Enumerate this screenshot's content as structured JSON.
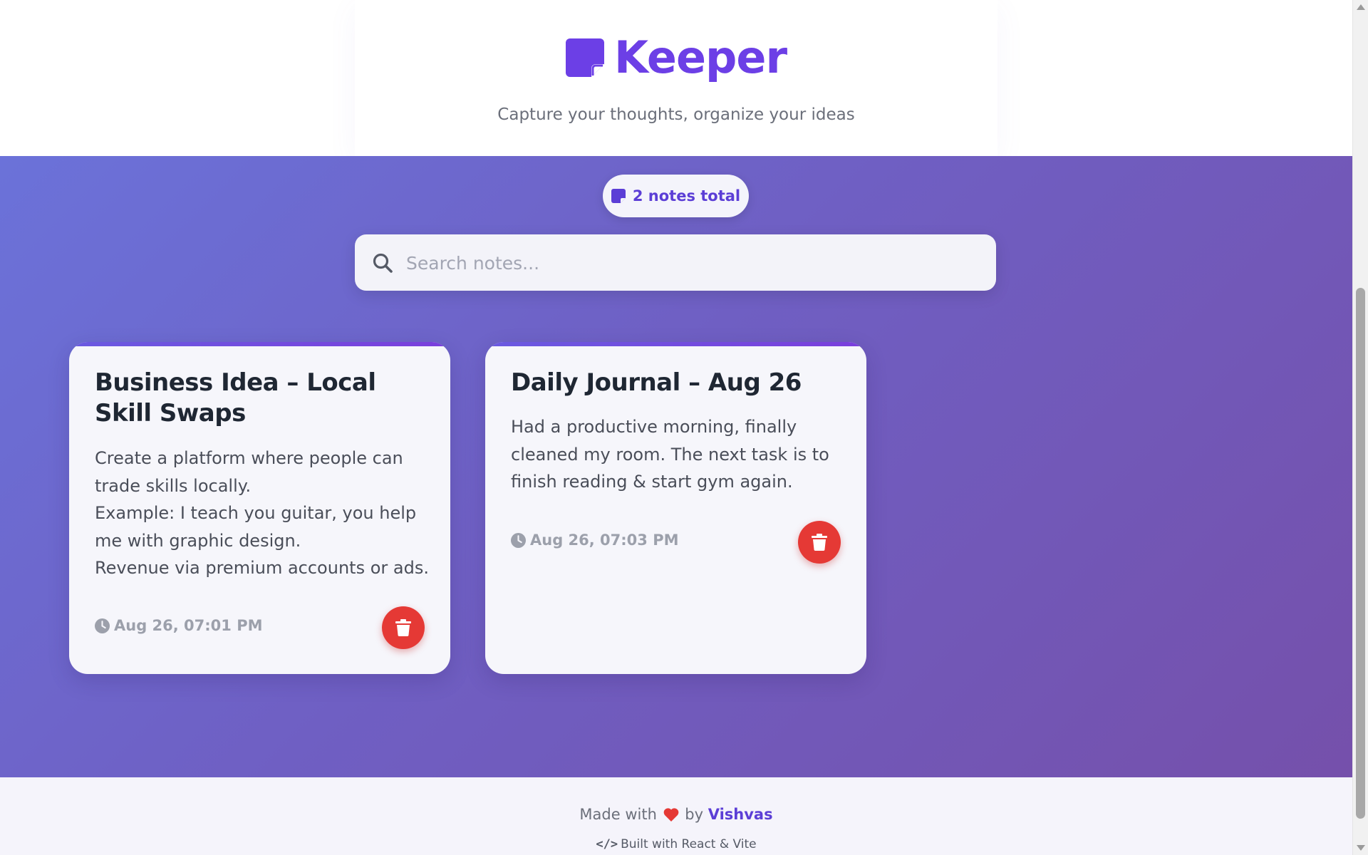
{
  "app": {
    "name": "Keeper",
    "tagline": "Capture your thoughts, organize your ideas",
    "brand_color": "#6c3fe6"
  },
  "stats": {
    "count_label": "2 notes total"
  },
  "search": {
    "placeholder": "Search notes...",
    "value": ""
  },
  "notes": [
    {
      "title": "Business Idea – Local Skill Swaps",
      "body": "Create a platform where people can trade skills locally.\nExample: I teach you guitar, you help me with graphic design.\nRevenue via premium accounts or ads.",
      "timestamp": "Aug 26, 07:01 PM"
    },
    {
      "title": "Daily Journal – Aug 26",
      "body": "Had a productive morning, finally cleaned my room. The next task is to finish reading & start gym again.",
      "timestamp": "Aug 26, 07:03 PM"
    }
  ],
  "footer": {
    "made_with": "Made with",
    "by": "by",
    "author": "Vishvas",
    "built_with": "Built with React & Vite"
  },
  "colors": {
    "accent": "#5b3ed6",
    "delete": "#e53935",
    "gradient_start": "#6b72d9",
    "gradient_end": "#7550ab"
  },
  "icons": {
    "brand": "sticky-note-icon",
    "search": "search-icon",
    "clock": "clock-icon",
    "delete": "trash-icon",
    "heart": "heart-icon",
    "code": "code-icon"
  }
}
